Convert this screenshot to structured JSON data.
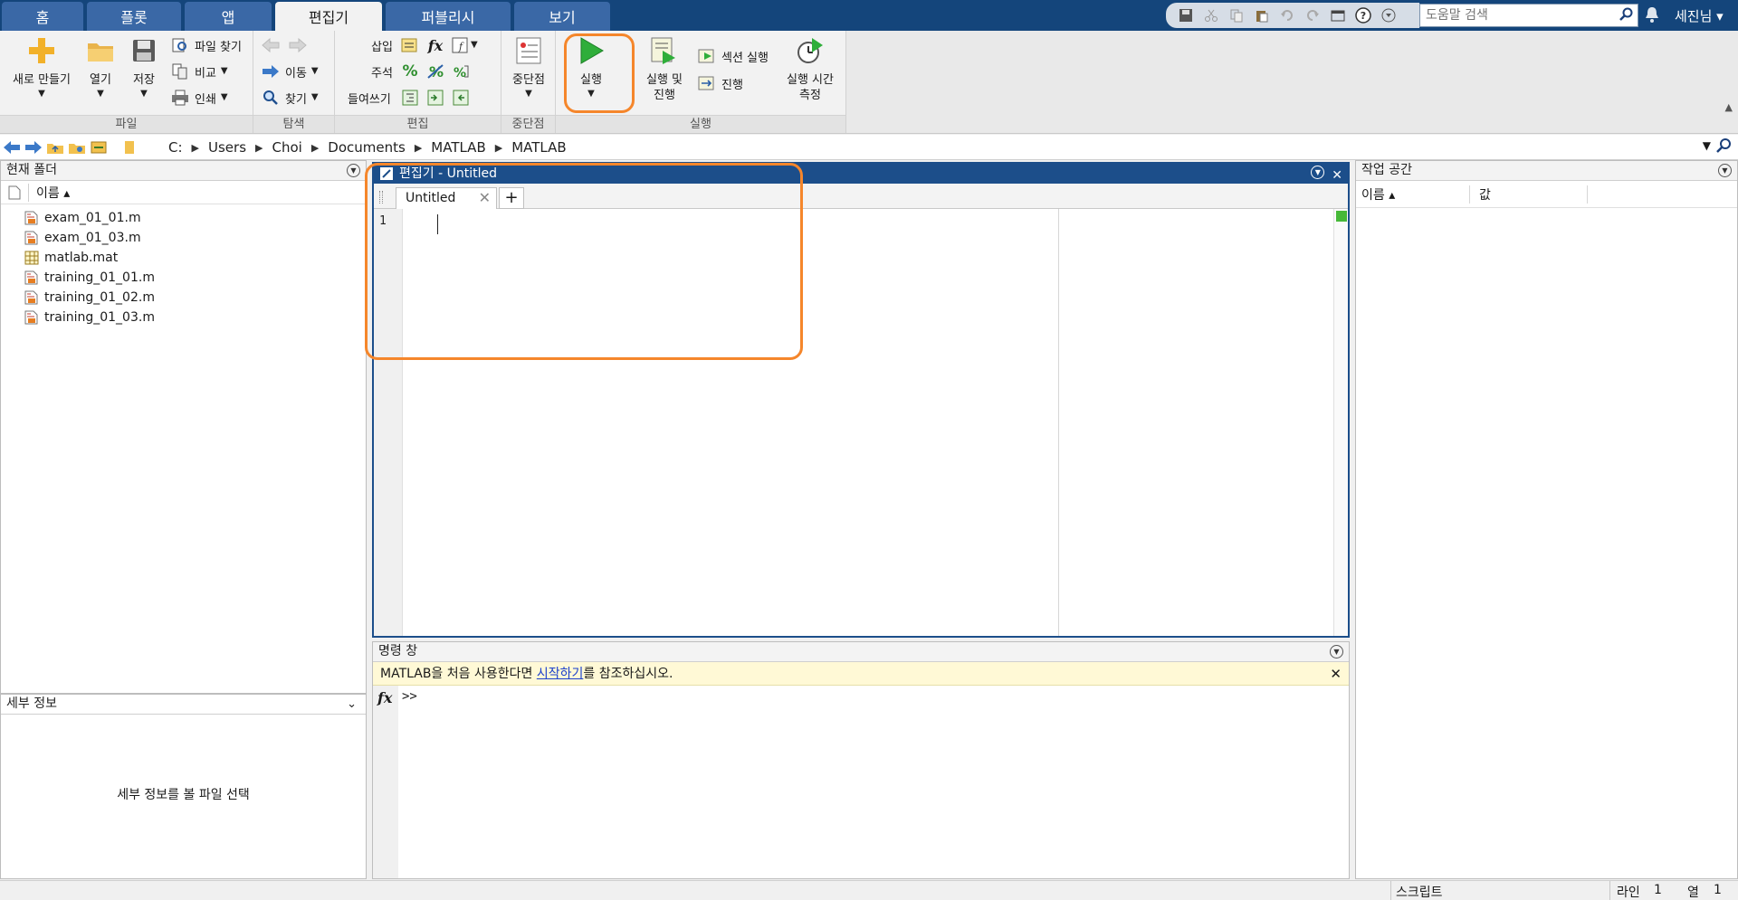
{
  "tabs": [
    "홈",
    "플롯",
    "앱",
    "편집기",
    "퍼블리시",
    "보기"
  ],
  "active_tab": "편집기",
  "search": {
    "placeholder": "도움말 검색"
  },
  "user": "세진님",
  "ribbon": {
    "file": {
      "label": "파일",
      "new": "새로 만들기",
      "open": "열기",
      "save": "저장",
      "find_files": "파일 찾기",
      "compare": "비교",
      "print": "인쇄"
    },
    "navigate": {
      "label": "탐색",
      "goto": "이동",
      "find": "찾기"
    },
    "edit": {
      "label": "편집",
      "insert": "삽입",
      "comment": "주석",
      "indent": "들여쓰기"
    },
    "breakpoints": {
      "label": "중단점",
      "breakpoints": "중단점"
    },
    "run": {
      "label": "실행",
      "run": "실행",
      "run_advance_line1": "실행 및",
      "run_advance_line2": "진행",
      "run_section": "섹션 실행",
      "advance": "진행",
      "run_time_line1": "실행 시간",
      "run_time_line2": "측정"
    }
  },
  "path": [
    "C:",
    "Users",
    "Choi",
    "Documents",
    "MATLAB",
    "MATLAB"
  ],
  "current_folder": {
    "title": "현재 폴더",
    "col_name": "이름 ▴",
    "files": [
      {
        "name": "exam_01_01.m",
        "type": "m"
      },
      {
        "name": "exam_01_03.m",
        "type": "m"
      },
      {
        "name": "matlab.mat",
        "type": "mat"
      },
      {
        "name": "training_01_01.m",
        "type": "m"
      },
      {
        "name": "training_01_02.m",
        "type": "m"
      },
      {
        "name": "training_01_03.m",
        "type": "m"
      }
    ]
  },
  "details": {
    "title": "세부 정보",
    "message": "세부 정보를 볼 파일 선택"
  },
  "editor": {
    "title": "편집기 - Untitled",
    "tab": "Untitled",
    "line_number": "1"
  },
  "command_window": {
    "title": "명령 창",
    "banner_pre": "MATLAB을 처음 사용한다면 ",
    "banner_link": "시작하기",
    "banner_post": "를 참조하십시오.",
    "prompt": ">>"
  },
  "workspace": {
    "title": "작업 공간",
    "col_name": "이름 ▴",
    "col_value": "값"
  },
  "status": {
    "mode": "스크립트",
    "line_label": "라인",
    "line": "1",
    "col_label": "열",
    "col": "1"
  },
  "colors": {
    "tabbar": "#14457b",
    "editor_title": "#1c4e8a",
    "highlight": "#f5862b",
    "run_green": "#2fae3a"
  }
}
